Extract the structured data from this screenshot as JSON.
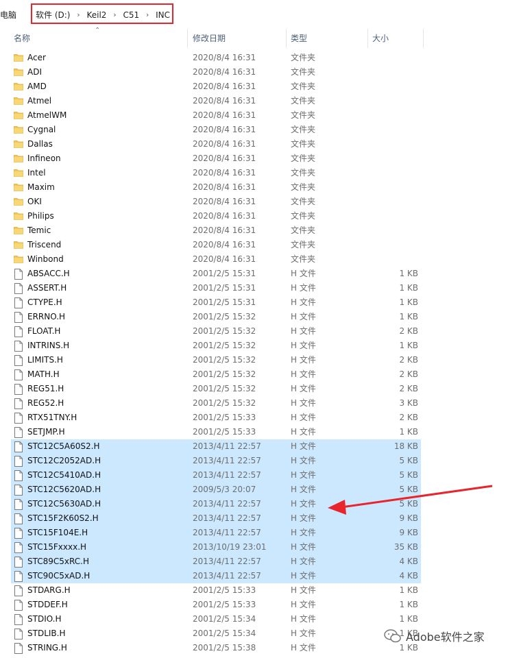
{
  "breadcrumb": {
    "root": "电脑",
    "items": [
      "软件 (D:)",
      "Keil2",
      "C51",
      "INC"
    ]
  },
  "header": {
    "name": "名称",
    "date": "修改日期",
    "type": "类型",
    "size": "大小"
  },
  "files": [
    {
      "name": "Acer",
      "date": "2020/8/4 16:31",
      "type": "文件夹",
      "size": "",
      "kind": "folder",
      "selected": false
    },
    {
      "name": "ADI",
      "date": "2020/8/4 16:31",
      "type": "文件夹",
      "size": "",
      "kind": "folder",
      "selected": false
    },
    {
      "name": "AMD",
      "date": "2020/8/4 16:31",
      "type": "文件夹",
      "size": "",
      "kind": "folder",
      "selected": false
    },
    {
      "name": "Atmel",
      "date": "2020/8/4 16:31",
      "type": "文件夹",
      "size": "",
      "kind": "folder",
      "selected": false
    },
    {
      "name": "AtmelWM",
      "date": "2020/8/4 16:31",
      "type": "文件夹",
      "size": "",
      "kind": "folder",
      "selected": false
    },
    {
      "name": "Cygnal",
      "date": "2020/8/4 16:31",
      "type": "文件夹",
      "size": "",
      "kind": "folder",
      "selected": false
    },
    {
      "name": "Dallas",
      "date": "2020/8/4 16:31",
      "type": "文件夹",
      "size": "",
      "kind": "folder",
      "selected": false
    },
    {
      "name": "Infineon",
      "date": "2020/8/4 16:31",
      "type": "文件夹",
      "size": "",
      "kind": "folder",
      "selected": false
    },
    {
      "name": "Intel",
      "date": "2020/8/4 16:31",
      "type": "文件夹",
      "size": "",
      "kind": "folder",
      "selected": false
    },
    {
      "name": "Maxim",
      "date": "2020/8/4 16:31",
      "type": "文件夹",
      "size": "",
      "kind": "folder",
      "selected": false
    },
    {
      "name": "OKI",
      "date": "2020/8/4 16:31",
      "type": "文件夹",
      "size": "",
      "kind": "folder",
      "selected": false
    },
    {
      "name": "Philips",
      "date": "2020/8/4 16:31",
      "type": "文件夹",
      "size": "",
      "kind": "folder",
      "selected": false
    },
    {
      "name": "Temic",
      "date": "2020/8/4 16:31",
      "type": "文件夹",
      "size": "",
      "kind": "folder",
      "selected": false
    },
    {
      "name": "Triscend",
      "date": "2020/8/4 16:31",
      "type": "文件夹",
      "size": "",
      "kind": "folder",
      "selected": false
    },
    {
      "name": "Winbond",
      "date": "2020/8/4 16:31",
      "type": "文件夹",
      "size": "",
      "kind": "folder",
      "selected": false
    },
    {
      "name": "ABSACC.H",
      "date": "2001/2/5 15:31",
      "type": "H 文件",
      "size": "1 KB",
      "kind": "file",
      "selected": false
    },
    {
      "name": "ASSERT.H",
      "date": "2001/2/5 15:31",
      "type": "H 文件",
      "size": "1 KB",
      "kind": "file",
      "selected": false
    },
    {
      "name": "CTYPE.H",
      "date": "2001/2/5 15:31",
      "type": "H 文件",
      "size": "1 KB",
      "kind": "file",
      "selected": false
    },
    {
      "name": "ERRNO.H",
      "date": "2001/2/5 15:32",
      "type": "H 文件",
      "size": "1 KB",
      "kind": "file",
      "selected": false
    },
    {
      "name": "FLOAT.H",
      "date": "2001/2/5 15:32",
      "type": "H 文件",
      "size": "2 KB",
      "kind": "file",
      "selected": false
    },
    {
      "name": "INTRINS.H",
      "date": "2001/2/5 15:32",
      "type": "H 文件",
      "size": "1 KB",
      "kind": "file",
      "selected": false
    },
    {
      "name": "LIMITS.H",
      "date": "2001/2/5 15:32",
      "type": "H 文件",
      "size": "2 KB",
      "kind": "file",
      "selected": false
    },
    {
      "name": "MATH.H",
      "date": "2001/2/5 15:32",
      "type": "H 文件",
      "size": "2 KB",
      "kind": "file",
      "selected": false
    },
    {
      "name": "REG51.H",
      "date": "2001/2/5 15:32",
      "type": "H 文件",
      "size": "2 KB",
      "kind": "file",
      "selected": false
    },
    {
      "name": "REG52.H",
      "date": "2001/2/5 15:32",
      "type": "H 文件",
      "size": "3 KB",
      "kind": "file",
      "selected": false
    },
    {
      "name": "RTX51TNY.H",
      "date": "2001/2/5 15:33",
      "type": "H 文件",
      "size": "2 KB",
      "kind": "file",
      "selected": false
    },
    {
      "name": "SETJMP.H",
      "date": "2001/2/5 15:33",
      "type": "H 文件",
      "size": "1 KB",
      "kind": "file",
      "selected": false
    },
    {
      "name": "STC12C5A60S2.H",
      "date": "2013/4/11 22:57",
      "type": "H 文件",
      "size": "18 KB",
      "kind": "file",
      "selected": true
    },
    {
      "name": "STC12C2052AD.H",
      "date": "2013/4/11 22:57",
      "type": "H 文件",
      "size": "5 KB",
      "kind": "file",
      "selected": true
    },
    {
      "name": "STC12C5410AD.H",
      "date": "2013/4/11 22:57",
      "type": "H 文件",
      "size": "5 KB",
      "kind": "file",
      "selected": true
    },
    {
      "name": "STC12C5620AD.H",
      "date": "2009/5/3 20:07",
      "type": "H 文件",
      "size": "5 KB",
      "kind": "file",
      "selected": true
    },
    {
      "name": "STC12C5630AD.H",
      "date": "2013/4/11 22:57",
      "type": "H 文件",
      "size": "5 KB",
      "kind": "file",
      "selected": true
    },
    {
      "name": "STC15F2K60S2.H",
      "date": "2013/4/11 22:57",
      "type": "H 文件",
      "size": "9 KB",
      "kind": "file",
      "selected": true
    },
    {
      "name": "STC15F104E.H",
      "date": "2013/4/11 22:57",
      "type": "H 文件",
      "size": "9 KB",
      "kind": "file",
      "selected": true
    },
    {
      "name": "STC15Fxxxx.H",
      "date": "2013/10/19 23:01",
      "type": "H 文件",
      "size": "35 KB",
      "kind": "file",
      "selected": true
    },
    {
      "name": "STC89C5xRC.H",
      "date": "2013/4/11 22:57",
      "type": "H 文件",
      "size": "4 KB",
      "kind": "file",
      "selected": true
    },
    {
      "name": "STC90C5xAD.H",
      "date": "2013/4/11 22:57",
      "type": "H 文件",
      "size": "4 KB",
      "kind": "file",
      "selected": true
    },
    {
      "name": "STDARG.H",
      "date": "2001/2/5 15:33",
      "type": "H 文件",
      "size": "1 KB",
      "kind": "file",
      "selected": false
    },
    {
      "name": "STDDEF.H",
      "date": "2001/2/5 15:33",
      "type": "H 文件",
      "size": "1 KB",
      "kind": "file",
      "selected": false
    },
    {
      "name": "STDIO.H",
      "date": "2001/2/5 15:34",
      "type": "H 文件",
      "size": "1 KB",
      "kind": "file",
      "selected": false
    },
    {
      "name": "STDLIB.H",
      "date": "2001/2/5 15:34",
      "type": "H 文件",
      "size": "1 KB",
      "kind": "file",
      "selected": false
    },
    {
      "name": "STRING.H",
      "date": "2001/2/5 15:38",
      "type": "H 文件",
      "size": "1 KB",
      "kind": "file",
      "selected": false
    }
  ],
  "watermark": "Adobe软件之家",
  "colors": {
    "highlight_box": "#e8242c",
    "selection": "#cce8ff",
    "arrow": "#e8242c",
    "folder": "#f4c55b"
  }
}
